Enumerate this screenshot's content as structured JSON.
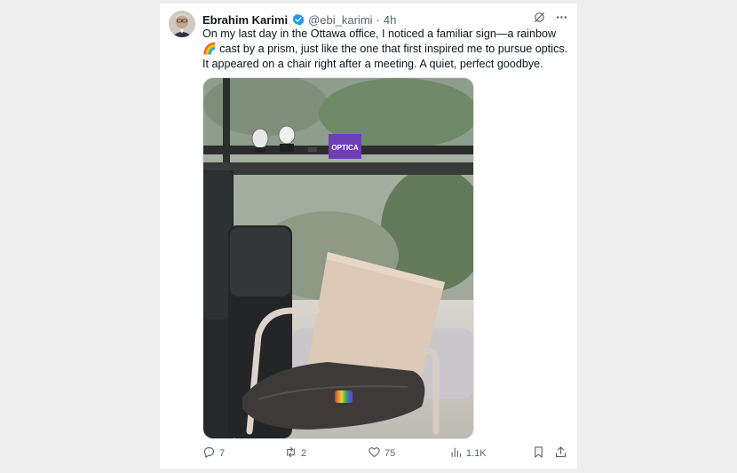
{
  "tweet": {
    "author_name": "Ebrahim Karimi",
    "handle": "@ebi_karimi",
    "separator": "·",
    "time": "4h",
    "text": "On my last day in the Ottawa office, I noticed a familiar sign—a rainbow 🌈 cast by a prism, just like the one that first inspired me to pursue optics. It appeared on a chair right after a meeting. A quiet, perfect goodbye.",
    "media_label": "OPTICA"
  },
  "actions": {
    "replies": "7",
    "reposts": "2",
    "likes": "75",
    "views": "1.1K"
  },
  "colors": {
    "verified": "#1d9bf0",
    "text": "#0f1419",
    "secondary": "#536471",
    "background": "#eeeeef"
  },
  "icons": [
    "verified-badge-icon",
    "grok-icon",
    "more-icon",
    "reply-icon",
    "repost-icon",
    "like-icon",
    "views-icon",
    "bookmark-icon",
    "share-icon"
  ]
}
